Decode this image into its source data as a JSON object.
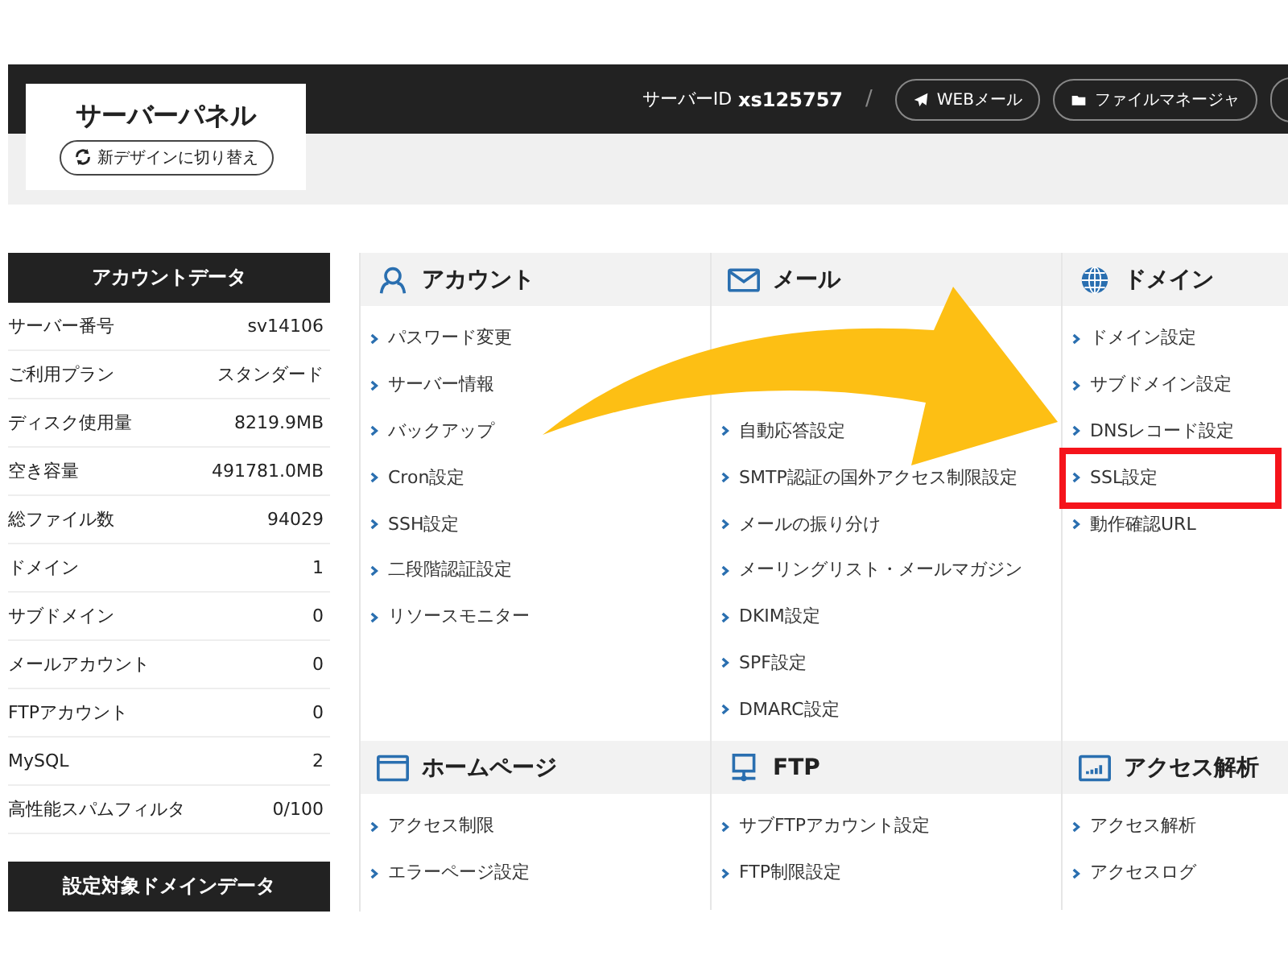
{
  "panel": {
    "title": "サーバーパネル",
    "switch_button": "新デザインに切り替え"
  },
  "header": {
    "server_id_label": "サーバーID",
    "server_id": "xs125757",
    "separator": "/",
    "buttons": [
      "WEBメール",
      "ファイルマネージャ"
    ]
  },
  "account_data": {
    "title": "アカウントデータ",
    "rows": [
      {
        "label": "サーバー番号",
        "value": "sv14106"
      },
      {
        "label": "ご利用プラン",
        "value": "スタンダード"
      },
      {
        "label": "ディスク使用量",
        "value": "8219.9MB"
      },
      {
        "label": "空き容量",
        "value": "491781.0MB"
      },
      {
        "label": "総ファイル数",
        "value": "94029"
      },
      {
        "label": "ドメイン",
        "value": "1"
      },
      {
        "label": "サブドメイン",
        "value": "0"
      },
      {
        "label": "メールアカウント",
        "value": "0"
      },
      {
        "label": "FTPアカウント",
        "value": "0"
      },
      {
        "label": "MySQL",
        "value": "2"
      },
      {
        "label": "高性能スパムフィルタ",
        "value": "0/100"
      }
    ]
  },
  "domain_data": {
    "title": "設定対象ドメインデータ"
  },
  "sections": [
    {
      "kind": "account",
      "title": "アカウント",
      "items": [
        {
          "kind": "link",
          "label": "パスワード変更",
          "highlighted": false
        },
        {
          "kind": "link",
          "label": "サーバー情報",
          "highlighted": false
        },
        {
          "kind": "link",
          "label": "バックアップ",
          "highlighted": false
        },
        {
          "kind": "link",
          "label": "Cron設定",
          "highlighted": false
        },
        {
          "kind": "link",
          "label": "SSH設定",
          "highlighted": false
        },
        {
          "kind": "link",
          "label": "二段階認証設定",
          "highlighted": false
        },
        {
          "kind": "link",
          "label": "リソースモニター",
          "highlighted": false
        }
      ]
    },
    {
      "kind": "mail",
      "title": "メール",
      "items": [
        {
          "kind": "covered"
        },
        {
          "kind": "covered"
        },
        {
          "kind": "link",
          "label": "自動応答設定",
          "highlighted": false
        },
        {
          "kind": "link",
          "label": "SMTP認証の国外アクセス制限設定",
          "highlighted": false
        },
        {
          "kind": "link",
          "label": "メールの振り分け",
          "highlighted": false
        },
        {
          "kind": "link",
          "label": "メーリングリスト・メールマガジン",
          "highlighted": false
        },
        {
          "kind": "link",
          "label": "DKIM設定",
          "highlighted": false
        },
        {
          "kind": "link",
          "label": "SPF設定",
          "highlighted": false
        },
        {
          "kind": "link",
          "label": "DMARC設定",
          "highlighted": false
        }
      ]
    },
    {
      "kind": "domain",
      "title": "ドメイン",
      "items": [
        {
          "kind": "link",
          "label": "ドメイン設定",
          "highlighted": false
        },
        {
          "kind": "link",
          "label": "サブドメイン設定",
          "highlighted": false
        },
        {
          "kind": "link",
          "label": "DNSレコード設定",
          "highlighted": false
        },
        {
          "kind": "link",
          "label": "SSL設定",
          "highlighted": true
        },
        {
          "kind": "link",
          "label": "動作確認URL",
          "highlighted": false
        }
      ]
    },
    {
      "kind": "homepage",
      "title": "ホームページ",
      "items": [
        {
          "kind": "link",
          "label": "アクセス制限",
          "highlighted": false
        },
        {
          "kind": "link",
          "label": "エラーページ設定",
          "highlighted": false
        }
      ]
    },
    {
      "kind": "ftp",
      "title": "FTP",
      "items": [
        {
          "kind": "link",
          "label": "サブFTPアカウント設定",
          "highlighted": false
        },
        {
          "kind": "link",
          "label": "FTP制限設定",
          "highlighted": false
        }
      ]
    },
    {
      "kind": "analytics",
      "title": "アクセス解析",
      "items": [
        {
          "kind": "link",
          "label": "アクセス解析",
          "highlighted": false
        },
        {
          "kind": "link",
          "label": "アクセスログ",
          "highlighted": false
        }
      ]
    }
  ]
}
